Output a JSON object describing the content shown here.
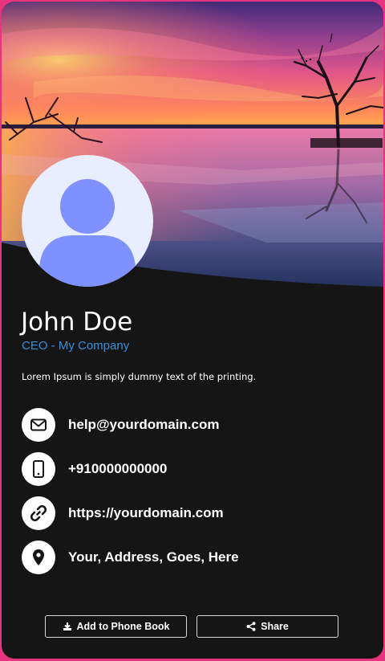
{
  "profile": {
    "name": "John Doe",
    "title": "CEO - My Company",
    "bio": "Lorem Ipsum is simply dummy text of the printing."
  },
  "contacts": [
    {
      "icon": "envelope-icon",
      "value": "help@yourdomain.com"
    },
    {
      "icon": "mobile-phone-icon",
      "value": "+910000000000"
    },
    {
      "icon": "link-icon",
      "value": "https://yourdomain.com"
    },
    {
      "icon": "map-pin-icon",
      "value": "Your, Address, Goes, Here"
    }
  ],
  "actions": {
    "add_label": "Add to Phone Book",
    "share_label": "Share"
  },
  "colors": {
    "border": "#e8347f",
    "background": "#151515",
    "accent": "#3390e0",
    "avatar": "#7f91ff"
  }
}
